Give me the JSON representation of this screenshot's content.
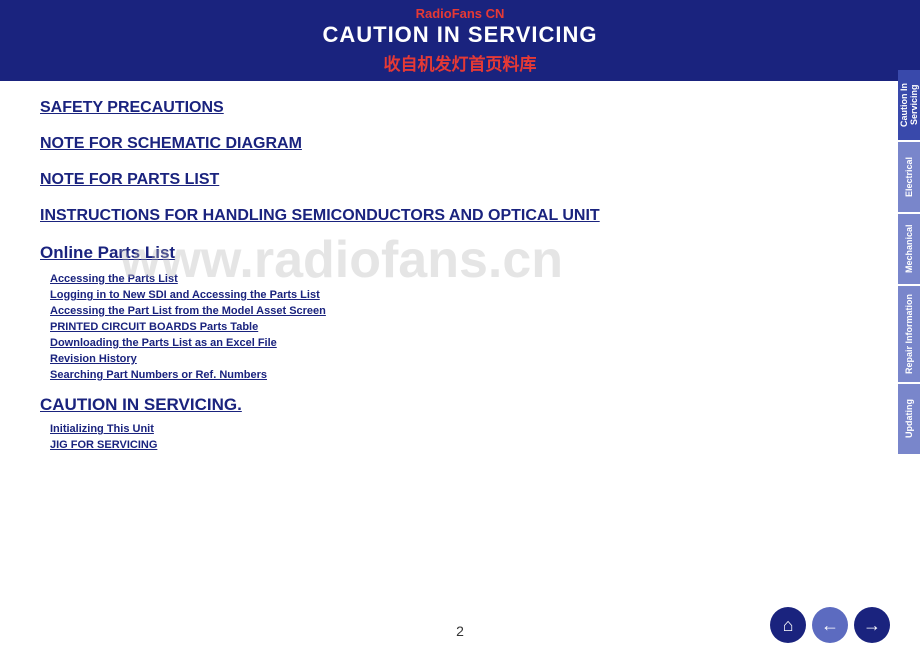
{
  "header": {
    "watermark_top": "RadioFans CN",
    "title": "CAUTION IN SERVICING",
    "watermark_bottom": "收自机发灯首页料库"
  },
  "watermark": "www.radiofans.cn",
  "sidebar": {
    "tabs": [
      {
        "id": "caution",
        "label": "Caution In Servicing",
        "active": true
      },
      {
        "id": "electrical",
        "label": "Electrical",
        "active": false
      },
      {
        "id": "mechanical",
        "label": "Mechanical",
        "active": false
      },
      {
        "id": "repair",
        "label": "Repair Information",
        "active": false
      },
      {
        "id": "updating",
        "label": "Updating",
        "active": false
      }
    ]
  },
  "main": {
    "links": [
      {
        "id": "safety",
        "label": "SAFETY PRECAUTIONS"
      },
      {
        "id": "schematic",
        "label": "NOTE FOR SCHEMATIC DIAGRAM"
      },
      {
        "id": "parts",
        "label": "NOTE FOR PARTS LIST"
      },
      {
        "id": "semiconductors",
        "label": "INSTRUCTIONS FOR HANDLING SEMICONDUCTORS AND OPTICAL UNIT"
      }
    ],
    "online_parts": {
      "title": "Online Parts List",
      "sub_links": [
        {
          "id": "accessing",
          "label": "Accessing the Parts List"
        },
        {
          "id": "logging",
          "label": "Logging in to New SDI and Accessing the Parts List"
        },
        {
          "id": "accessing_model",
          "label": "Accessing the Part List from the Model Asset Screen"
        },
        {
          "id": "pcb_table",
          "label": "PRINTED CIRCUIT BOARDS Parts Table"
        },
        {
          "id": "downloading",
          "label": "Downloading the Parts List as an Excel File"
        },
        {
          "id": "revision",
          "label": "Revision History"
        },
        {
          "id": "searching",
          "label": "Searching Part Numbers or Ref. Numbers"
        }
      ]
    },
    "caution_servicing": {
      "title": "CAUTION IN SERVICING.",
      "sub_links": [
        {
          "id": "initializing",
          "label": "Initializing This Unit"
        },
        {
          "id": "jig",
          "label": "JIG FOR SERVICING"
        }
      ]
    }
  },
  "footer": {
    "page_number": "2",
    "nav": {
      "home_label": "⌂",
      "back_label": "←",
      "forward_label": "→"
    }
  }
}
